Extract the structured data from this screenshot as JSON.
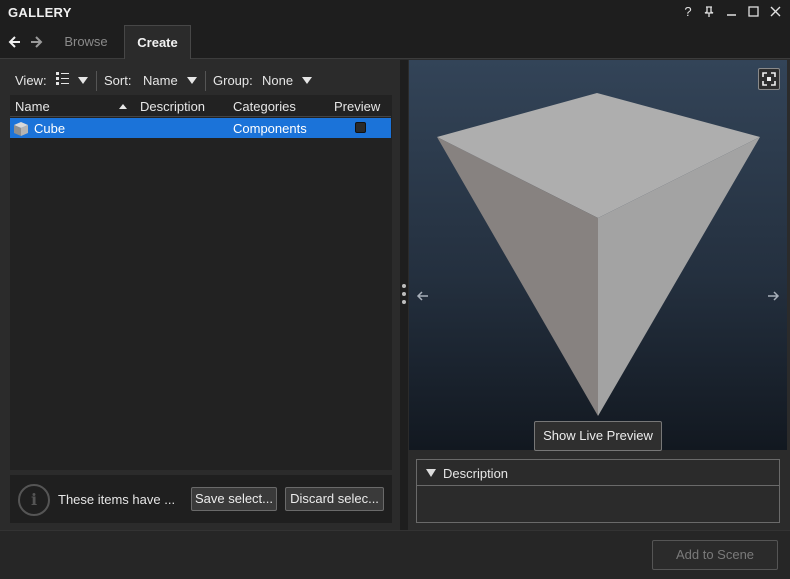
{
  "window": {
    "title": "GALLERY",
    "buttons": {
      "help": "?",
      "pin": "pin-icon",
      "minimize": "minimize-icon",
      "maximize": "maximize-icon",
      "close": "close-icon"
    }
  },
  "tabs": [
    {
      "label": "Browse",
      "active": false
    },
    {
      "label": "Create",
      "active": true
    }
  ],
  "toolbar": {
    "view_label": "View:",
    "view_value_icon": "list-view-icon",
    "sort_label": "Sort:",
    "sort_value": "Name",
    "group_label": "Group:",
    "group_value": "None"
  },
  "list": {
    "columns": [
      "Name",
      "Description",
      "Categories",
      "Preview"
    ],
    "sort_column": "Name",
    "sort_direction": "ascending",
    "rows": [
      {
        "name": "Cube",
        "description": "",
        "category": "Components",
        "preview": true,
        "selected": true,
        "icon": "cube-icon"
      }
    ]
  },
  "info": {
    "text": "These items have ...",
    "save_button": "Save select...",
    "discard_button": "Discard selec..."
  },
  "preview": {
    "live_button": "Show Live Preview",
    "background_top": "#334458",
    "background_bottom": "#121820"
  },
  "description_panel": {
    "label": "Description",
    "content": ""
  },
  "footer": {
    "add_button": "Add to Scene",
    "add_enabled": false
  },
  "colors": {
    "selection": "#1b73d9",
    "panel": "#2b2b2b",
    "titlebar": "#1e1e1e"
  }
}
